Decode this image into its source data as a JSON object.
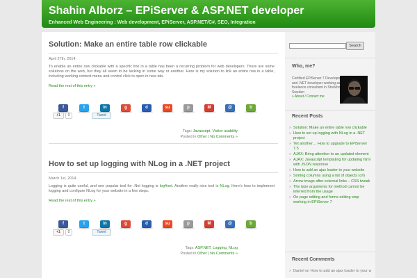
{
  "header": {
    "title": "Shahin Alborz – EPiServer & ASP.NET developer",
    "tagline": "Enhanced Web Engineering : Web development, EPiServer, ASP.NET/C#, SEO, Integration"
  },
  "posts": [
    {
      "title": "Solution: Make an entire table row clickable",
      "date": "April 27th, 2014",
      "excerpt": "To enable an entire row clickable with a specific link in a table has been a recurring problem for web developers. There are some solutions on the web, but they all seem to be lacking in some way or another. Here is my solution to link an entire row in a table, including working context menu and control click to open in new tab.",
      "read_more": "Read the rest of this entry »",
      "gplus_label": "+1",
      "gplus_count": "0",
      "tweet_label": "Tweet",
      "tags_label": "Tags:",
      "tags": [
        "Javascript",
        "Visitor usability"
      ],
      "posted_label": "Posted in",
      "category": "Other",
      "comments": "No Comments »"
    },
    {
      "title": "How to set up logging with NLog in a .NET project",
      "date": "March 1st, 2014",
      "excerpt_pre": "Logging is quite useful, and one popular tool for .Net logging is",
      "link1": "log4net",
      "excerpt_mid": ". Another really nice tool is",
      "link2": "NLog",
      "excerpt_post": ". Here’s how to implement logging and configure NLog for your website in a few steps.",
      "read_more": "Read the rest of this entry »",
      "gplus_label": "+1",
      "gplus_count": "0",
      "tweet_label": "Tweet",
      "tags_label": "Tags:",
      "tags": [
        "ASP.NET",
        "Logging",
        "NLog"
      ],
      "posted_label": "Posted in",
      "category": "Other",
      "comments": "No Comments »"
    }
  ],
  "share_icons": [
    {
      "name": "facebook-icon",
      "color": "#3b5998",
      "glyph": "f"
    },
    {
      "name": "twitter-icon",
      "color": "#2aa3ef",
      "glyph": "t"
    },
    {
      "name": "linkedin-icon",
      "color": "#0e76a8",
      "glyph": "in"
    },
    {
      "name": "google-icon",
      "color": "#dd4b39",
      "glyph": "g"
    },
    {
      "name": "delicious-icon",
      "color": "#2a5db0",
      "glyph": "d"
    },
    {
      "name": "stumbleupon-icon",
      "color": "#eb4924",
      "glyph": "su"
    },
    {
      "name": "print-icon",
      "color": "#9a9a9a",
      "glyph": "p"
    },
    {
      "name": "gmail-icon",
      "color": "#d23f31",
      "glyph": "M"
    },
    {
      "name": "email-icon",
      "color": "#3a6fb5",
      "glyph": "@"
    },
    {
      "name": "bookmark-icon",
      "color": "#6fa83a",
      "glyph": "b"
    }
  ],
  "sidebar": {
    "search_button": "Search",
    "who_title": "Who, me?",
    "about_text": "Certified EPiServer 7 Developer and .NET developer working as a freelance consultant in Stockholm, Sweden",
    "about_link": "» About / Contact me",
    "recent_title": "Recent Posts",
    "recent_posts": [
      "Solution: Make an entire table row clickable",
      "How to set up logging with NLog in a .NET project",
      "Yet another… How to upgrade to EPiServer 7.5",
      "AJAX: Bring attention to an updated element",
      "AJAX: Javascript templating for updating html with JSON response",
      "How to add an ajax loader to your website",
      "Sorting columns using a list of objects (c#)",
      "Arrow image after external links – CSS tweak",
      "The type arguments for method cannot be inferred from the usage",
      "On page editing and forms editing stop working in EPiServer 7"
    ],
    "comments_title": "Recent Comments",
    "recent_comments": [
      "Daniel on How to add an ajax loader to your website"
    ]
  }
}
